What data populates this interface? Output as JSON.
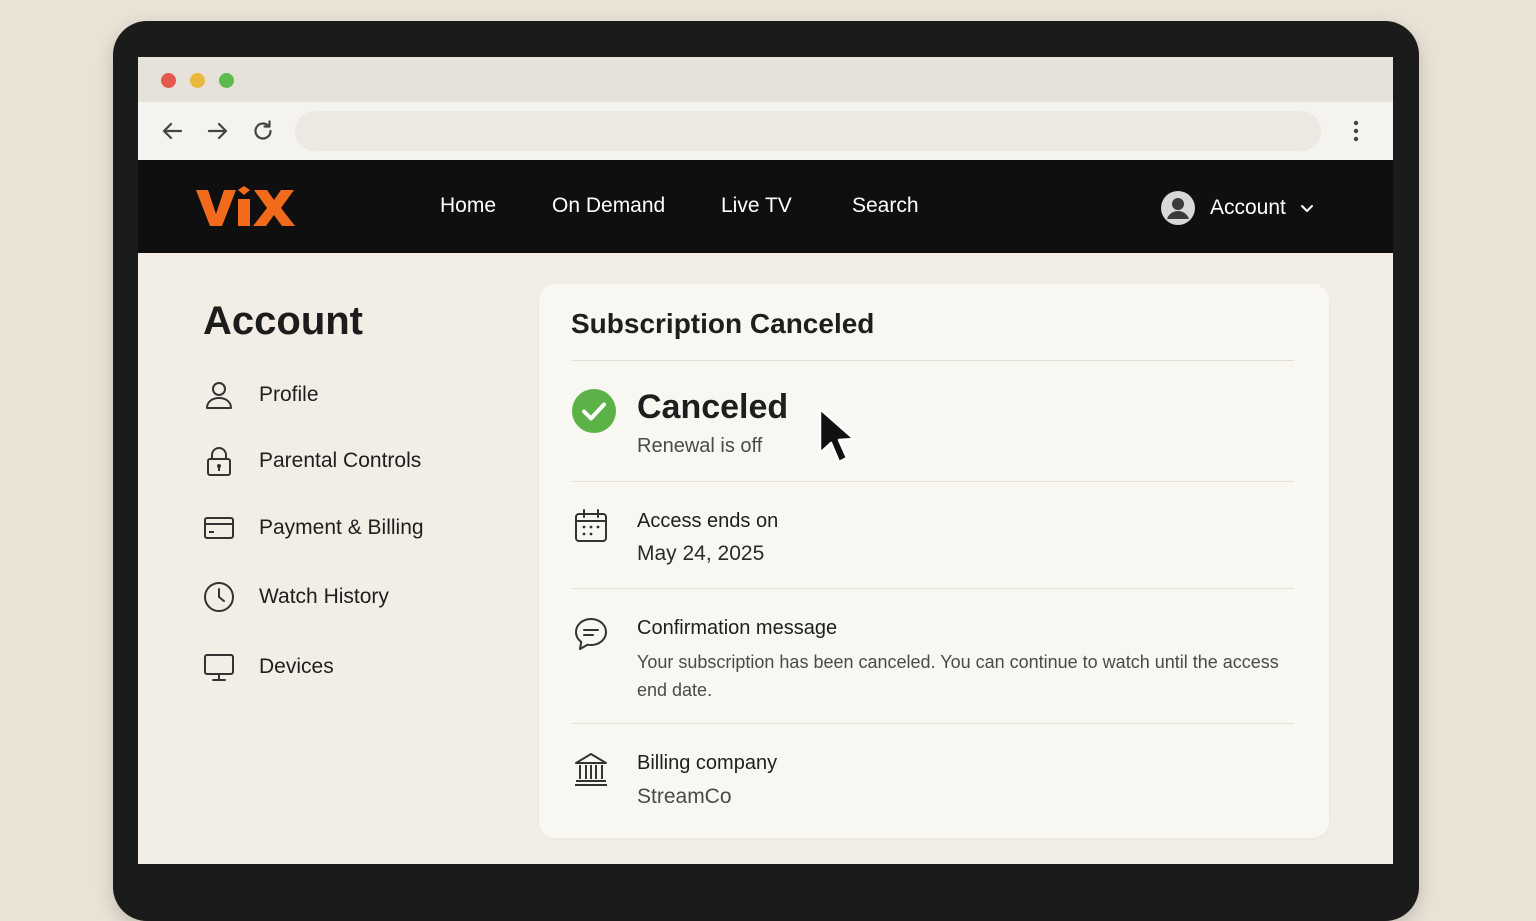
{
  "browser": {
    "url": "",
    "icons": [
      "back-arrow-icon",
      "forward-arrow-icon",
      "reload-icon",
      "kebab-menu-icon"
    ]
  },
  "site": {
    "logo_text": "ViX",
    "brand_color": "#f26b1d",
    "nav": [
      "Home",
      "On Demand",
      "Live TV",
      "Search"
    ],
    "account_label": "Account"
  },
  "sidebar": {
    "title": "Account",
    "items": [
      {
        "label": "Profile",
        "icon": "user-icon"
      },
      {
        "label": "Parental Controls",
        "icon": "lock-icon"
      },
      {
        "label": "Payment & Billing",
        "icon": "credit-card-icon"
      },
      {
        "label": "Watch History",
        "icon": "clock-icon"
      },
      {
        "label": "Devices",
        "icon": "monitor-icon"
      }
    ]
  },
  "card": {
    "title": "Subscription Canceled",
    "status": {
      "title": "Canceled",
      "subtitle": "Renewal is off",
      "icon": "check-circle-icon",
      "color": "#5cb246"
    },
    "access": {
      "label": "Access ends on",
      "value": "May 24, 2025",
      "icon": "calendar-icon"
    },
    "confirmation": {
      "label": "Confirmation message",
      "text": "Your subscription has been canceled. You can continue to watch until the access end date.",
      "icon": "chat-bubble-icon"
    },
    "billing": {
      "label": "Billing company",
      "value": "StreamCo",
      "icon": "bank-icon"
    }
  }
}
